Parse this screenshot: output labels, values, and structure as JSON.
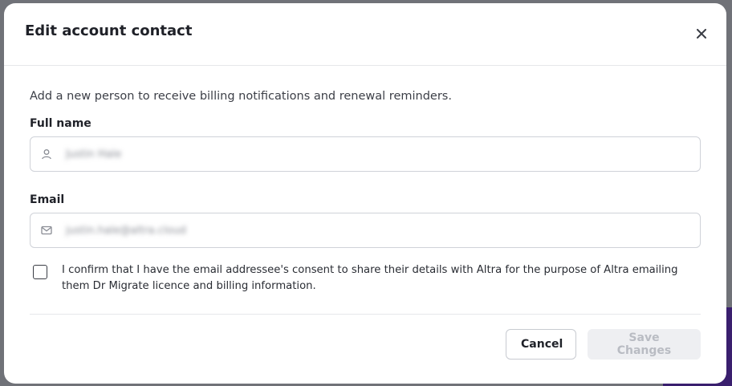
{
  "modal": {
    "title": "Edit account contact",
    "intro": "Add a new person to receive billing notifications and renewal reminders.",
    "full_name": {
      "label": "Full name",
      "value": "Justin Hale",
      "icon": "user-icon"
    },
    "email": {
      "label": "Email",
      "value": "justin.hale@altra.cloud",
      "icon": "mail-icon"
    },
    "consent_text": "I confirm that I have the email addressee's consent to share their details with Altra for the purpose of Altra emailing them Dr Migrate licence and billing information.",
    "consent_checked": false,
    "cancel_label": "Cancel",
    "save_label": "Save Changes"
  },
  "colors": {
    "overlay": "#707278",
    "modal_bg": "#ffffff",
    "disabled_button_bg": "#eeeff2",
    "disabled_button_text": "#b9bcc3"
  }
}
